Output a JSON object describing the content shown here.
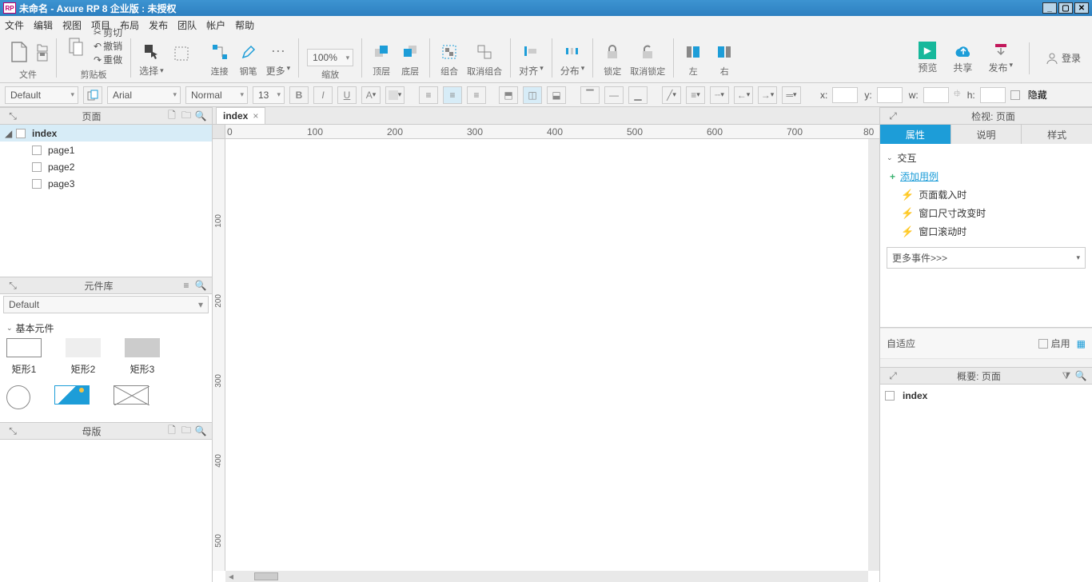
{
  "title": "未命名 - Axure RP 8 企业版 : 未授权",
  "menus": [
    "文件",
    "编辑",
    "视图",
    "项目",
    "布局",
    "发布",
    "团队",
    "帐户",
    "帮助"
  ],
  "toolbar": {
    "file": "文件",
    "clipboard": "剪贴板",
    "cut": "剪切",
    "undo": "撤销",
    "redo": "重做",
    "select": "选择",
    "connect": "连接",
    "pen": "钢笔",
    "more": "更多",
    "zoom_value": "100%",
    "zoom": "缩放",
    "front": "顶层",
    "back": "底层",
    "group": "组合",
    "ungroup": "取消组合",
    "align": "对齐",
    "distribute": "分布",
    "lock": "锁定",
    "unlock": "取消锁定",
    "left": "左",
    "right": "右",
    "preview": "预览",
    "share": "共享",
    "publish": "发布",
    "login": "登录"
  },
  "format": {
    "style": "Default",
    "font": "Arial",
    "weight": "Normal",
    "size": "13",
    "x": "x:",
    "y": "y:",
    "w": "w:",
    "h": "h:",
    "hidden": "隐藏"
  },
  "panels": {
    "pages": "页面",
    "widgets": "元件库",
    "masters": "母版",
    "inspect": "检视: 页面",
    "outline": "概要: 页面"
  },
  "pages_tree": {
    "root": "index",
    "children": [
      "page1",
      "page2",
      "page3"
    ]
  },
  "widget_lib": {
    "default": "Default",
    "section": "基本元件",
    "shapes": [
      "矩形1",
      "矩形2",
      "矩形3"
    ]
  },
  "tab": "index",
  "ruler_h": [
    "0",
    "100",
    "200",
    "300",
    "400",
    "500",
    "600",
    "700",
    "80"
  ],
  "ruler_v": [
    "100",
    "200",
    "300",
    "400",
    "500"
  ],
  "inspector": {
    "tab_props": "属性",
    "tab_notes": "说明",
    "tab_style": "样式",
    "interactions": "交互",
    "add_case": "添加用例",
    "evt_load": "页面载入时",
    "evt_resize": "窗口尺寸改变时",
    "evt_scroll": "窗口滚动时",
    "more_events": "更多事件>>>",
    "adaptive": "自适应",
    "enable": "启用"
  },
  "outline_item": "index"
}
